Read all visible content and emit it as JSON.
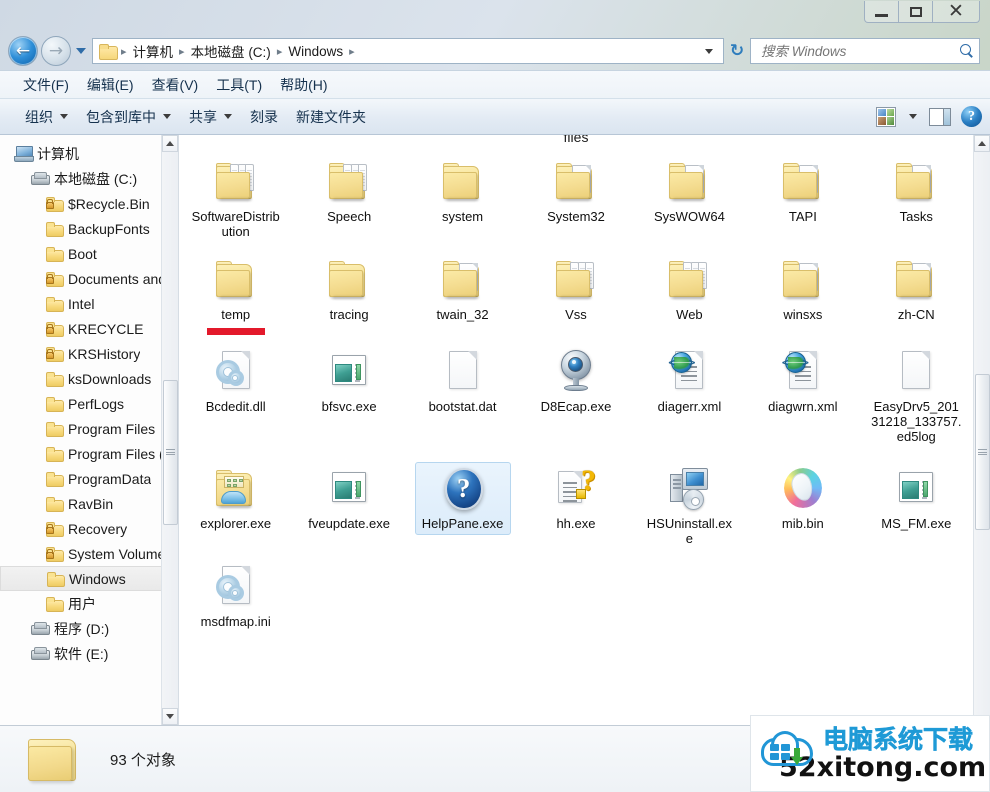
{
  "window": {
    "controls": {
      "minimize": "minimize",
      "maximize": "maximize",
      "close": "close"
    }
  },
  "address": {
    "back_tooltip": "后退",
    "forward_tooltip": "前进",
    "folder_icon": "folder-icon",
    "crumbs": [
      "计算机",
      "本地磁盘 (C:)",
      "Windows"
    ],
    "separator": "▸",
    "refresh_glyph": "↻"
  },
  "search": {
    "placeholder": "搜索 Windows",
    "value": "",
    "icon": "search-icon"
  },
  "menubar": {
    "items": [
      "文件(F)",
      "编辑(E)",
      "查看(V)",
      "工具(T)",
      "帮助(H)"
    ]
  },
  "toolbar": {
    "buttons": [
      {
        "label": "组织",
        "has_caret": true
      },
      {
        "label": "包含到库中",
        "has_caret": true
      },
      {
        "label": "共享",
        "has_caret": true
      },
      {
        "label": "刻录",
        "has_caret": false
      },
      {
        "label": "新建文件夹",
        "has_caret": false
      }
    ],
    "view_icon": "view-options-icon",
    "view_caret": "chevron-down-icon",
    "preview_icon": "preview-pane-icon",
    "help_icon": "help-icon",
    "help_glyph": "?"
  },
  "sidebar": {
    "items": [
      {
        "label": "计算机",
        "icon": "computer-icon",
        "indent": 0,
        "locked": false,
        "selected": false
      },
      {
        "label": "本地磁盘 (C:)",
        "icon": "drive-icon",
        "indent": 1,
        "locked": false,
        "selected": false
      },
      {
        "label": "$Recycle.Bin",
        "icon": "folder-icon",
        "indent": 2,
        "locked": true,
        "selected": false
      },
      {
        "label": "BackupFonts",
        "icon": "folder-icon",
        "indent": 2,
        "locked": false,
        "selected": false
      },
      {
        "label": "Boot",
        "icon": "folder-icon",
        "indent": 2,
        "locked": false,
        "selected": false
      },
      {
        "label": "Documents and",
        "icon": "folder-icon",
        "indent": 2,
        "locked": true,
        "selected": false
      },
      {
        "label": "Intel",
        "icon": "folder-icon",
        "indent": 2,
        "locked": false,
        "selected": false
      },
      {
        "label": "KRECYCLE",
        "icon": "folder-icon",
        "indent": 2,
        "locked": true,
        "selected": false
      },
      {
        "label": "KRSHistory",
        "icon": "folder-icon",
        "indent": 2,
        "locked": true,
        "selected": false
      },
      {
        "label": "ksDownloads",
        "icon": "folder-icon",
        "indent": 2,
        "locked": false,
        "selected": false
      },
      {
        "label": "PerfLogs",
        "icon": "folder-icon",
        "indent": 2,
        "locked": false,
        "selected": false
      },
      {
        "label": "Program Files",
        "icon": "folder-icon",
        "indent": 2,
        "locked": false,
        "selected": false
      },
      {
        "label": "Program Files (",
        "icon": "folder-icon",
        "indent": 2,
        "locked": false,
        "selected": false
      },
      {
        "label": "ProgramData",
        "icon": "folder-icon",
        "indent": 2,
        "locked": false,
        "selected": false
      },
      {
        "label": "RavBin",
        "icon": "folder-icon",
        "indent": 2,
        "locked": false,
        "selected": false
      },
      {
        "label": "Recovery",
        "icon": "folder-icon",
        "indent": 2,
        "locked": true,
        "selected": false
      },
      {
        "label": "System Volume",
        "icon": "folder-icon",
        "indent": 2,
        "locked": true,
        "selected": false
      },
      {
        "label": "Windows",
        "icon": "folder-icon",
        "indent": 2,
        "locked": false,
        "selected": true
      },
      {
        "label": "用户",
        "icon": "folder-icon",
        "indent": 2,
        "locked": false,
        "selected": false
      },
      {
        "label": "程序 (D:)",
        "icon": "drive-icon",
        "indent": 1,
        "locked": false,
        "selected": false
      },
      {
        "label": "软件 (E:)",
        "icon": "drive-icon",
        "indent": 1,
        "locked": false,
        "selected": false
      }
    ]
  },
  "content": {
    "clipped_top_text": "files",
    "items": [
      {
        "name": "SoftwareDistribution",
        "icon": "folder-papers-icon",
        "selected": false,
        "annotated": false
      },
      {
        "name": "Speech",
        "icon": "folder-papers-icon",
        "selected": false,
        "annotated": false
      },
      {
        "name": "system",
        "icon": "folder-icon",
        "selected": false,
        "annotated": false
      },
      {
        "name": "System32",
        "icon": "folder-doc-icon",
        "selected": false,
        "annotated": false
      },
      {
        "name": "SysWOW64",
        "icon": "folder-doc-icon",
        "selected": false,
        "annotated": false
      },
      {
        "name": "TAPI",
        "icon": "folder-doc-icon",
        "selected": false,
        "annotated": false
      },
      {
        "name": "Tasks",
        "icon": "folder-doc-icon",
        "selected": false,
        "annotated": false
      },
      {
        "name": "temp",
        "icon": "folder-icon",
        "selected": false,
        "annotated": true
      },
      {
        "name": "tracing",
        "icon": "folder-icon",
        "selected": false,
        "annotated": false
      },
      {
        "name": "twain_32",
        "icon": "folder-doc-icon",
        "selected": false,
        "annotated": false
      },
      {
        "name": "Vss",
        "icon": "folder-papers-icon",
        "selected": false,
        "annotated": false
      },
      {
        "name": "Web",
        "icon": "folder-papers-icon",
        "selected": false,
        "annotated": false
      },
      {
        "name": "winsxs",
        "icon": "folder-doc-icon",
        "selected": false,
        "annotated": false
      },
      {
        "name": "zh-CN",
        "icon": "folder-doc-icon",
        "selected": false,
        "annotated": false
      },
      {
        "name": "Bcdedit.dll",
        "icon": "gear-document-icon",
        "selected": false,
        "annotated": false
      },
      {
        "name": "bfsvc.exe",
        "icon": "application-icon",
        "selected": false,
        "annotated": false
      },
      {
        "name": "bootstat.dat",
        "icon": "blank-document-icon",
        "selected": false,
        "annotated": false
      },
      {
        "name": "D8Ecap.exe",
        "icon": "webcam-icon",
        "selected": false,
        "annotated": false
      },
      {
        "name": "diagerr.xml",
        "icon": "xml-document-icon",
        "selected": false,
        "annotated": false
      },
      {
        "name": "diagwrn.xml",
        "icon": "xml-document-icon",
        "selected": false,
        "annotated": false
      },
      {
        "name": "EasyDrv5_20131218_133757.ed5log",
        "icon": "blank-document-icon",
        "selected": false,
        "annotated": false
      },
      {
        "name": "explorer.exe",
        "icon": "explorer-icon",
        "selected": false,
        "annotated": false
      },
      {
        "name": "fveupdate.exe",
        "icon": "application-icon",
        "selected": false,
        "annotated": false
      },
      {
        "name": "HelpPane.exe",
        "icon": "help-question-icon",
        "selected": true,
        "annotated": false
      },
      {
        "name": "hh.exe",
        "icon": "help-document-icon",
        "selected": false,
        "annotated": false
      },
      {
        "name": "HSUninstall.exe",
        "icon": "uninstall-icon",
        "selected": false,
        "annotated": false
      },
      {
        "name": "mib.bin",
        "icon": "rainbow-swirl-icon",
        "selected": false,
        "annotated": false
      },
      {
        "name": "MS_FM.exe",
        "icon": "application-icon",
        "selected": false,
        "annotated": false
      },
      {
        "name": "msdfmap.ini",
        "icon": "gear-document-icon",
        "selected": false,
        "annotated": false
      }
    ]
  },
  "statusbar": {
    "icon": "folder-icon",
    "text": "93 个对象"
  },
  "watermark": {
    "icon": "cloud-download-icon",
    "chinese": "电脑系统下载",
    "domain": "52xitong.com",
    "color_blue": "#1f9ad6",
    "color_green": "#3aa93a"
  },
  "colors": {
    "selection_blue": "#dcecfa",
    "annotation_red": "#e3192b",
    "folder_yellow": "#f4dc90"
  }
}
